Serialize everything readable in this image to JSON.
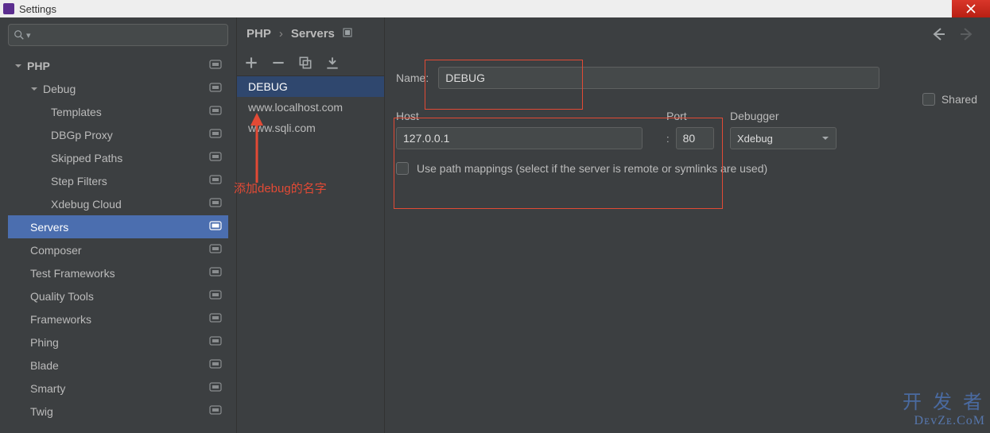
{
  "window": {
    "title": "Settings"
  },
  "sidebar": {
    "search_placeholder": "",
    "items": [
      {
        "label": "PHP",
        "level": 0,
        "expanded": true,
        "bold": true
      },
      {
        "label": "Debug",
        "level": 1,
        "expanded": true
      },
      {
        "label": "Templates",
        "level": 2
      },
      {
        "label": "DBGp Proxy",
        "level": 2
      },
      {
        "label": "Skipped Paths",
        "level": 2
      },
      {
        "label": "Step Filters",
        "level": 2
      },
      {
        "label": "Xdebug Cloud",
        "level": 2
      },
      {
        "label": "Servers",
        "level": 1,
        "selected": true
      },
      {
        "label": "Composer",
        "level": 1
      },
      {
        "label": "Test Frameworks",
        "level": 1
      },
      {
        "label": "Quality Tools",
        "level": 1
      },
      {
        "label": "Frameworks",
        "level": 1
      },
      {
        "label": "Phing",
        "level": 1
      },
      {
        "label": "Blade",
        "level": 1
      },
      {
        "label": "Smarty",
        "level": 1
      },
      {
        "label": "Twig",
        "level": 1
      }
    ]
  },
  "breadcrumb": {
    "part1": "PHP",
    "part2": "Servers"
  },
  "servers": {
    "items": [
      {
        "name": "DEBUG",
        "selected": true
      },
      {
        "name": "www.localhost.com"
      },
      {
        "name": "www.sqli.com"
      }
    ]
  },
  "annotation_text": "添加debug的名字",
  "form": {
    "name_label": "Name:",
    "name_value": "DEBUG",
    "shared_label": "Shared",
    "host_label": "Host",
    "host_value": "127.0.0.1",
    "port_label": "Port",
    "port_value": "80",
    "debugger_label": "Debugger",
    "debugger_value": "Xdebug",
    "path_mappings_label": "Use path mappings (select if the server is remote or symlinks are used)"
  },
  "watermark": {
    "line1": "开 发 者",
    "line2": "DᴇᴠZᴇ.CᴏM"
  }
}
